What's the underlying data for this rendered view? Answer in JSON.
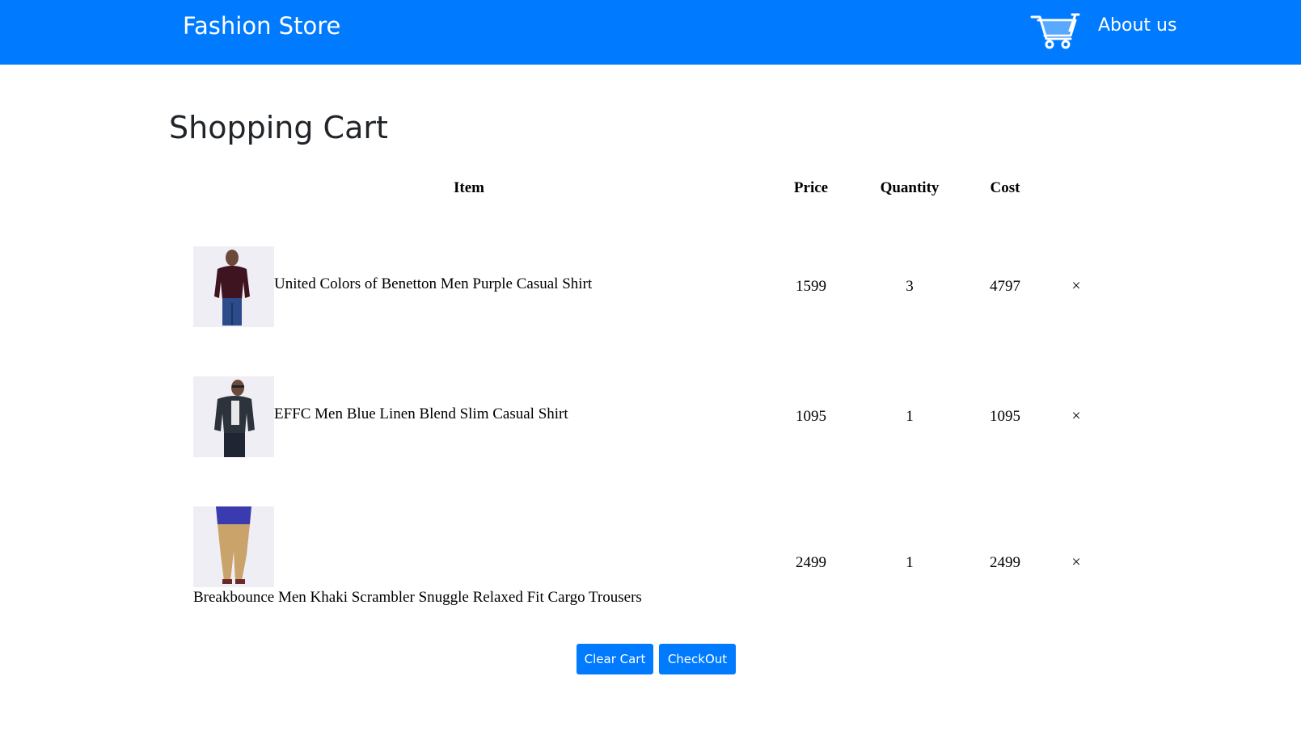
{
  "navbar": {
    "brand": "Fashion Store",
    "cart_icon": "shopping-cart-icon",
    "about_label": "About us",
    "background_color": "#007bff"
  },
  "page": {
    "title": "Shopping Cart"
  },
  "table": {
    "headers": {
      "item": "Item",
      "price": "Price",
      "quantity": "Quantity",
      "cost": "Cost"
    },
    "rows": [
      {
        "name": "United Colors of Benetton Men Purple Casual Shirt",
        "price": "1599",
        "quantity": "3",
        "cost": "4797",
        "remove": "×"
      },
      {
        "name": "EFFC Men Blue Linen Blend Slim Casual Shirt",
        "price": "1095",
        "quantity": "1",
        "cost": "1095",
        "remove": "×"
      },
      {
        "name": "Breakbounce Men Khaki Scrambler Snuggle Relaxed Fit Cargo Trousers",
        "price": "2499",
        "quantity": "1",
        "cost": "2499",
        "remove": "×"
      }
    ]
  },
  "actions": {
    "clear_label": "Clear Cart",
    "checkout_label": "CheckOut"
  }
}
